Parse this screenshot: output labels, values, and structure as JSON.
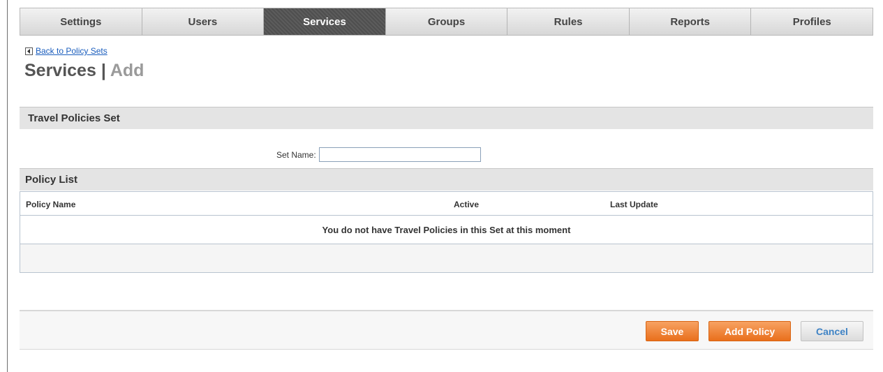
{
  "tabs": [
    {
      "label": "Settings",
      "active": false
    },
    {
      "label": "Users",
      "active": false
    },
    {
      "label": "Services",
      "active": true
    },
    {
      "label": "Groups",
      "active": false
    },
    {
      "label": "Rules",
      "active": false
    },
    {
      "label": "Reports",
      "active": false
    },
    {
      "label": "Profiles",
      "active": false
    }
  ],
  "back_link": {
    "label": "Back to Policy Sets",
    "icon": "back-arrow-icon"
  },
  "page_title": {
    "main": "Services",
    "separator": "|",
    "sub": "Add"
  },
  "travel_section": {
    "title": "Travel Policies Set",
    "set_name_label": "Set Name:",
    "set_name_value": ""
  },
  "policy_list": {
    "title": "Policy List",
    "columns": [
      "Policy Name",
      "Active",
      "Last Update"
    ],
    "empty_message": "You do not have Travel Policies in this Set at this moment"
  },
  "buttons": {
    "save": "Save",
    "add_policy": "Add Policy",
    "cancel": "Cancel"
  },
  "colors": {
    "accent_orange": "#ee7a2b",
    "link_blue": "#1a5dbd",
    "active_tab": "#555555"
  }
}
